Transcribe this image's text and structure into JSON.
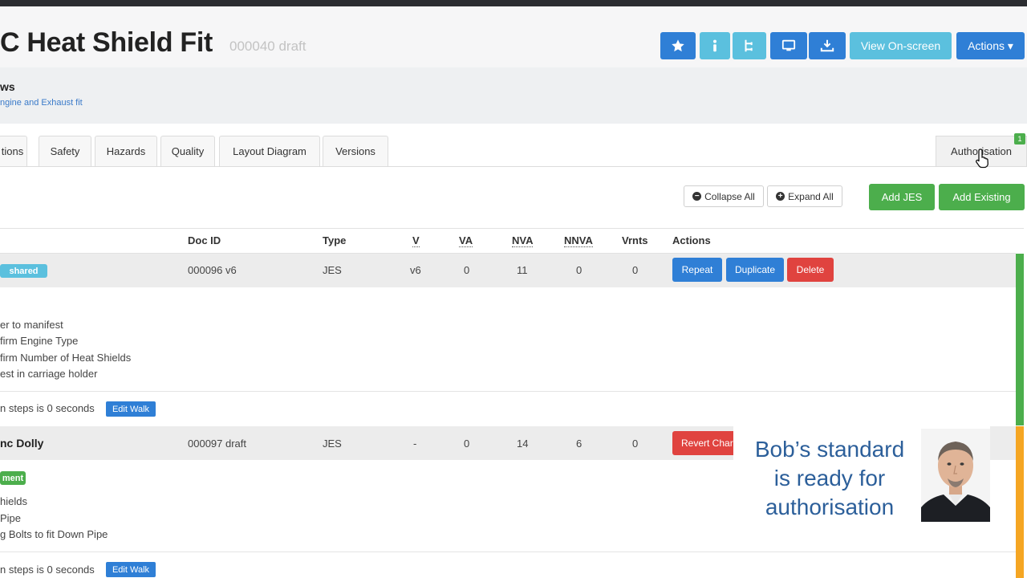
{
  "header": {
    "title": "C Heat Shield Fit",
    "doc_id": "000040 draft",
    "buttons": {
      "star": "star-icon",
      "info": "info-icon",
      "tree": "tree-icon",
      "monitor": "monitor-icon",
      "download": "download-icon",
      "view_onscreen": "View On-screen",
      "actions": "Actions ▾"
    }
  },
  "subheader": {
    "title": "ws",
    "link": "ngine and Exhaust fit"
  },
  "tabs": {
    "items": [
      "tions",
      "Safety",
      "Hazards",
      "Quality",
      "Layout Diagram",
      "Versions"
    ],
    "authorisation": "Authorisation",
    "authorisation_badge": "1"
  },
  "toolbar": {
    "collapse_all": "Collapse All",
    "expand_all": "Expand All",
    "add_jes": "Add JES",
    "add_existing": "Add Existing"
  },
  "table": {
    "columns": {
      "doc_id": "Doc ID",
      "type": "Type",
      "v": "V",
      "va": "VA",
      "nva": "NVA",
      "nnva": "NNVA",
      "vrnts": "Vrnts",
      "actions": "Actions"
    },
    "rows": [
      {
        "name": "",
        "badge": "shared",
        "doc_id": "000096 v6",
        "type": "JES",
        "v": "v6",
        "va": "0",
        "nva": "11",
        "nnva": "0",
        "vrnts": "0",
        "actions": [
          "Repeat",
          "Duplicate",
          "Delete"
        ],
        "steps": [
          "er to manifest",
          "firm Engine Type",
          "firm Number of Heat Shields",
          "est in carriage holder"
        ],
        "walk_text": "n steps is 0 seconds",
        "walk_button": "Edit Walk"
      },
      {
        "name": "nc Dolly",
        "badge": "ment",
        "doc_id": "000097 draft",
        "type": "JES",
        "v": "-",
        "va": "0",
        "nva": "14",
        "nnva": "6",
        "vrnts": "0",
        "actions": [
          "Revert Char"
        ],
        "steps": [
          "hields",
          "Pipe",
          "g Bolts to fit Down Pipe"
        ],
        "walk_text": "n steps is 0 seconds",
        "walk_button": "Edit Walk"
      }
    ]
  },
  "overlay": {
    "line1": "Bob’s standard",
    "line2": "is ready for",
    "line3": "authorisation"
  },
  "colors": {
    "primary": "#2f7fd6",
    "info": "#5bc0de",
    "success": "#4cae4c",
    "danger": "#e0433f",
    "row_border_green": "#4cae4c",
    "row_border_orange": "#f5a623"
  }
}
